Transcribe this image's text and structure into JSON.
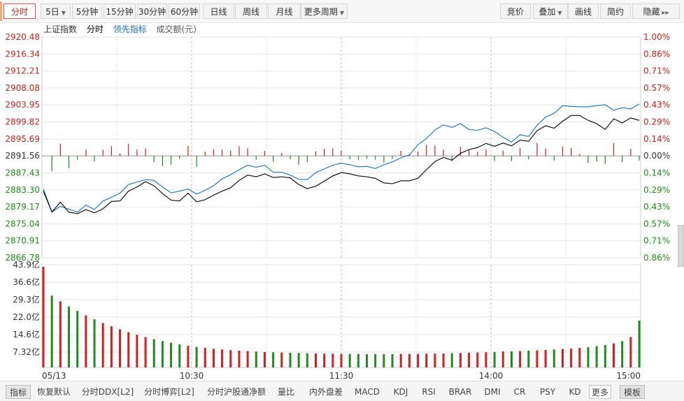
{
  "colors": {
    "up": "#d21f1f",
    "down": "#1f8b1f",
    "index_line": "#000000",
    "lead_line": "#1a6fc0",
    "grid": "#e6e6e6",
    "dashed_grid": "#bcbcbc",
    "accent": "#d02020"
  },
  "toolbar": {
    "tabs": [
      {
        "label": "分时",
        "active": true
      },
      {
        "label": "5日",
        "dropdown": true
      },
      {
        "label": "5分钟"
      },
      {
        "label": "15分钟"
      },
      {
        "label": "30分钟"
      },
      {
        "label": "60分钟"
      },
      {
        "label": "日线"
      },
      {
        "label": "周线"
      },
      {
        "label": "月线"
      },
      {
        "label": "更多周期",
        "dropdown": true
      }
    ],
    "right_tabs": [
      {
        "label": "竞价"
      },
      {
        "label": "叠加",
        "dropdown": true
      },
      {
        "label": "画线"
      },
      {
        "label": "简约"
      },
      {
        "label": "隐藏",
        "arrows": "▸▸"
      }
    ]
  },
  "legend": {
    "index_name": "上证指数",
    "time_label": "分时",
    "lead_label": "领先指标",
    "volume_label": "成交额(元)"
  },
  "bottom_tabs": [
    {
      "label": "指标",
      "active": true
    },
    {
      "label": "恢复默认"
    },
    {
      "label": "分时DDX[L2]"
    },
    {
      "label": "分时博弈[L2]"
    },
    {
      "label": "分时沪股通净额"
    },
    {
      "label": "量比"
    },
    {
      "label": "内外盘差"
    },
    {
      "label": "MACD"
    },
    {
      "label": "KDJ"
    },
    {
      "label": "RSI"
    },
    {
      "label": "BRAR"
    },
    {
      "label": "DMI"
    },
    {
      "label": "CR"
    },
    {
      "label": "PSY"
    },
    {
      "label": "KD"
    },
    {
      "label": "更多",
      "boxed": true
    },
    {
      "label": "模板",
      "template": true
    }
  ],
  "chart_data": {
    "type": "line",
    "date": "05/13",
    "prev_close": 2891.56,
    "price_ticks_left": [
      "2920.48",
      "2916.34",
      "2912.21",
      "2908.08",
      "2903.95",
      "2899.82",
      "2895.69",
      "2891.56",
      "2887.43",
      "2883.30",
      "2879.17",
      "2875.04",
      "2870.91",
      "2866.78"
    ],
    "price_ticks_right": [
      "1.00%",
      "0.86%",
      "0.71%",
      "0.57%",
      "0.43%",
      "0.29%",
      "0.14%",
      "0.00%",
      "0.14%",
      "0.29%",
      "0.43%",
      "0.57%",
      "0.71%",
      "0.86%"
    ],
    "x_ticks": [
      "05/13",
      "10:30",
      "11:30",
      "14:00",
      "15:00"
    ],
    "ylim_price": [
      2866.78,
      2920.48
    ],
    "volume_ticks": [
      "43.9亿",
      "36.6亿",
      "29.3亿",
      "22.0亿",
      "14.6亿",
      "7.32亿"
    ],
    "ylim_volume": [
      0,
      43.9
    ],
    "grid": true,
    "series": [
      {
        "name": "上证指数",
        "values": [
          2883.0,
          2877.9,
          2880.3,
          2877.9,
          2877.5,
          2878.5,
          2877.7,
          2878.7,
          2880.5,
          2880.6,
          2883.0,
          2884.0,
          2885.3,
          2884.3,
          2882.4,
          2880.8,
          2880.6,
          2882.5,
          2880.4,
          2880.9,
          2882.0,
          2883.0,
          2883.8,
          2885.6,
          2886.9,
          2886.5,
          2887.2,
          2886.3,
          2886.5,
          2886.2,
          2884.6,
          2883.6,
          2884.2,
          2885.4,
          2886.7,
          2887.5,
          2887.2,
          2886.7,
          2886.5,
          2886.1,
          2885.0,
          2884.8,
          2885.5,
          2885.5,
          2886.1,
          2888.2,
          2890.2,
          2891.2,
          2890.5,
          2892.2,
          2893.1,
          2893.6,
          2894.6,
          2893.9,
          2894.7,
          2894.0,
          2895.4,
          2895.1,
          2897.7,
          2898.9,
          2898.3,
          2900.0,
          2901.4,
          2901.4,
          2900.2,
          2899.4,
          2898.0,
          2900.6,
          2899.6,
          2900.8,
          2900.2
        ]
      },
      {
        "name": "领先指标",
        "values": [
          2883.5,
          2877.9,
          2879.3,
          2878.6,
          2877.9,
          2879.6,
          2878.5,
          2880.6,
          2881.5,
          2882.5,
          2884.6,
          2885.2,
          2885.8,
          2885.6,
          2884.0,
          2882.6,
          2883.0,
          2883.5,
          2882.3,
          2883.2,
          2884.3,
          2886.0,
          2887.0,
          2888.2,
          2889.3,
          2888.8,
          2889.3,
          2887.6,
          2887.6,
          2886.9,
          2885.9,
          2885.8,
          2887.5,
          2888.4,
          2889.3,
          2889.8,
          2889.4,
          2888.9,
          2889.0,
          2888.5,
          2889.4,
          2890.1,
          2891.1,
          2891.8,
          2894.3,
          2895.8,
          2897.9,
          2899.1,
          2898.5,
          2899.4,
          2898.0,
          2897.8,
          2898.4,
          2897.5,
          2896.1,
          2894.9,
          2896.7,
          2896.3,
          2899.0,
          2901.0,
          2901.9,
          2903.8,
          2903.6,
          2903.5,
          2903.5,
          2903.8,
          2904.0,
          2902.7,
          2903.3,
          2903.0,
          2904.2
        ]
      }
    ],
    "volume": [
      43.0,
      30.7,
      28.3,
      26.1,
      24.2,
      22.3,
      20.6,
      19.0,
      17.6,
      16.3,
      15.1,
      14.0,
      13.0,
      12.1,
      11.3,
      10.6,
      9.9,
      9.3,
      8.8,
      8.4,
      8.0,
      7.7,
      7.4,
      7.2,
      7.0,
      6.8,
      6.6,
      6.5,
      6.4,
      6.3,
      6.2,
      6.1,
      6.0,
      5.9,
      5.9,
      5.8,
      5.8,
      5.8,
      5.7,
      5.7,
      5.7,
      5.7,
      5.8,
      5.8,
      5.8,
      5.9,
      5.9,
      6.0,
      6.1,
      6.2,
      6.3,
      6.4,
      6.5,
      6.6,
      6.8,
      6.9,
      7.0,
      7.2,
      7.3,
      7.5,
      7.7,
      7.9,
      8.1,
      8.4,
      8.7,
      9.1,
      9.6,
      10.3,
      11.3,
      13.0,
      20.0
    ]
  }
}
